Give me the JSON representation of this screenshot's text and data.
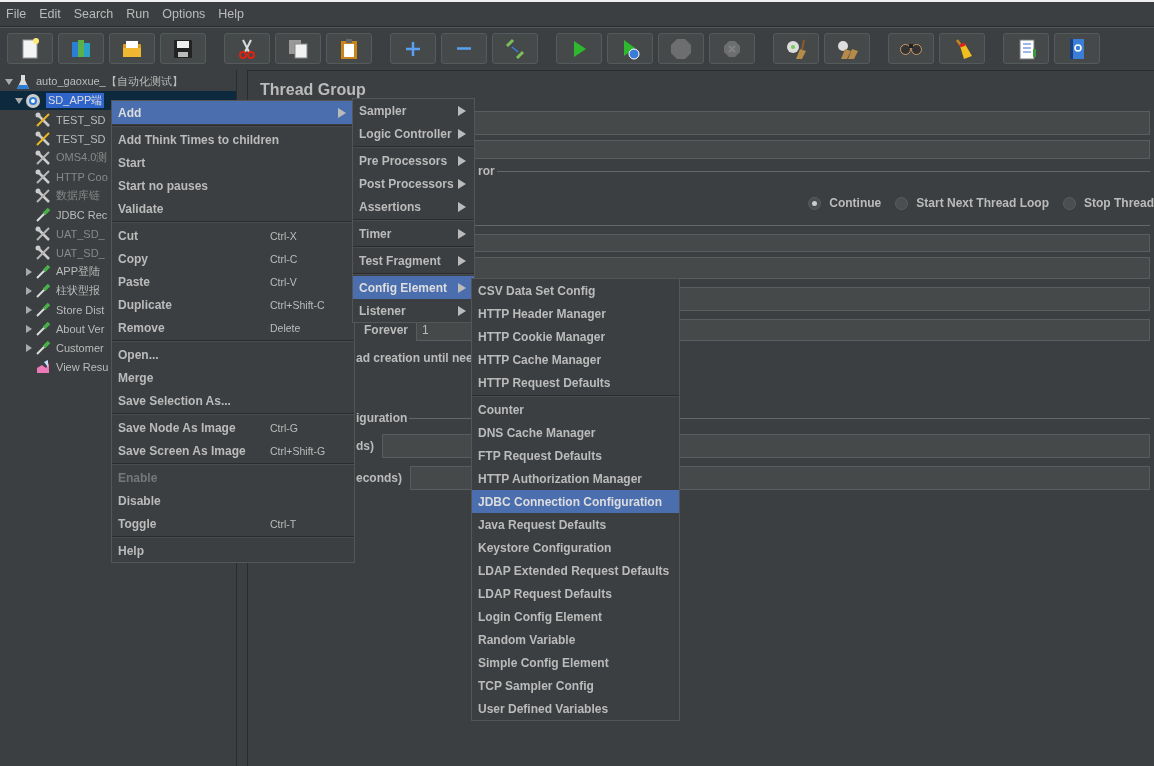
{
  "menubar": [
    "File",
    "Edit",
    "Search",
    "Run",
    "Options",
    "Help"
  ],
  "toolbar": {
    "groups": [
      [
        {
          "disabled": false
        },
        {
          "disabled": false
        },
        {
          "disabled": false
        },
        {
          "disabled": false
        }
      ],
      [
        {
          "disabled": false
        },
        {
          "disabled": false
        },
        {
          "disabled": false
        }
      ],
      [
        {
          "disabled": false
        },
        {
          "disabled": false
        },
        {
          "disabled": false
        }
      ],
      [
        {
          "disabled": false
        },
        {
          "disabled": false
        },
        {
          "disabled": true
        },
        {
          "disabled": true
        }
      ],
      [
        {
          "disabled": false
        },
        {
          "disabled": false
        }
      ],
      [
        {
          "disabled": false
        },
        {
          "disabled": false
        }
      ],
      [
        {
          "disabled": false
        },
        {
          "disabled": false
        }
      ]
    ]
  },
  "tree": [
    {
      "label": "auto_gaoxue_【自动化测试】",
      "kind": "plan",
      "expanded": true,
      "selected": false,
      "disabled": false,
      "children": [
        {
          "label": "SD_APP端",
          "kind": "threads",
          "expanded": true,
          "selected": true,
          "disabled": false,
          "children": [
            {
              "label": "TEST_SD",
              "kind": "config",
              "selected": false,
              "disabled": false
            },
            {
              "label": "TEST_SD",
              "kind": "config",
              "selected": false,
              "disabled": false
            },
            {
              "label": "OMS4.0测",
              "kind": "config",
              "selected": false,
              "disabled": true
            },
            {
              "label": "HTTP Coo",
              "kind": "config",
              "selected": false,
              "disabled": true
            },
            {
              "label": "数据库链",
              "kind": "config",
              "selected": false,
              "disabled": true
            },
            {
              "label": "JDBC Rec",
              "kind": "sampler",
              "selected": false,
              "disabled": false
            },
            {
              "label": "UAT_SD_",
              "kind": "config",
              "selected": false,
              "disabled": true
            },
            {
              "label": "UAT_SD_",
              "kind": "config",
              "selected": false,
              "disabled": true
            },
            {
              "label": "APP登陆",
              "kind": "sampler",
              "expanded": false,
              "selected": false,
              "disabled": false
            },
            {
              "label": "柱状型报",
              "kind": "sampler",
              "expanded": false,
              "selected": false,
              "disabled": false
            },
            {
              "label": "Store Dist",
              "kind": "sampler",
              "expanded": false,
              "selected": false,
              "disabled": false
            },
            {
              "label": "About Ver",
              "kind": "sampler",
              "expanded": false,
              "selected": false,
              "disabled": false
            },
            {
              "label": "Customer",
              "kind": "sampler",
              "expanded": false,
              "selected": false,
              "disabled": false
            },
            {
              "label": "View Resu",
              "kind": "listener",
              "selected": false,
              "disabled": false
            }
          ]
        }
      ]
    }
  ],
  "thread_group": {
    "title": "Thread Group",
    "error_legend": "ror",
    "error_actions": [
      {
        "label": "Continue",
        "selected": true
      },
      {
        "label": "Start Next Thread Loop",
        "selected": false
      },
      {
        "label": "Stop Thread",
        "selected": false
      }
    ],
    "loop_label": "Forever",
    "loop_value": "1",
    "delay_label": "ad creation until nee",
    "scheduler_legend": "iguration",
    "duration_label": "ds)",
    "startup_label": "econds)"
  },
  "context_menu": {
    "groups": [
      [
        {
          "label": "Add",
          "submenu": true,
          "selected": true,
          "disabled": false
        }
      ],
      [
        {
          "label": "Add Think Times to children",
          "selected": false,
          "disabled": false
        },
        {
          "label": "Start",
          "selected": false,
          "disabled": false
        },
        {
          "label": "Start no pauses",
          "selected": false,
          "disabled": false
        },
        {
          "label": "Validate",
          "selected": false,
          "disabled": false
        }
      ],
      [
        {
          "label": "Cut",
          "shortcut": "Ctrl-X",
          "selected": false,
          "disabled": false
        },
        {
          "label": "Copy",
          "shortcut": "Ctrl-C",
          "selected": false,
          "disabled": false
        },
        {
          "label": "Paste",
          "shortcut": "Ctrl-V",
          "selected": false,
          "disabled": false
        },
        {
          "label": "Duplicate",
          "shortcut": "Ctrl+Shift-C",
          "selected": false,
          "disabled": false
        },
        {
          "label": "Remove",
          "shortcut": "Delete",
          "selected": false,
          "disabled": false
        }
      ],
      [
        {
          "label": "Open...",
          "selected": false,
          "disabled": false
        },
        {
          "label": "Merge",
          "selected": false,
          "disabled": false
        },
        {
          "label": "Save Selection As...",
          "selected": false,
          "disabled": false
        }
      ],
      [
        {
          "label": "Save Node As Image",
          "shortcut": "Ctrl-G",
          "selected": false,
          "disabled": false
        },
        {
          "label": "Save Screen As Image",
          "shortcut": "Ctrl+Shift-G",
          "selected": false,
          "disabled": false
        }
      ],
      [
        {
          "label": "Enable",
          "selected": false,
          "disabled": true
        },
        {
          "label": "Disable",
          "selected": false,
          "disabled": false
        },
        {
          "label": "Toggle",
          "shortcut": "Ctrl-T",
          "selected": false,
          "disabled": false
        }
      ],
      [
        {
          "label": "Help",
          "selected": false,
          "disabled": false
        }
      ]
    ]
  },
  "add_menu": {
    "groups": [
      [
        {
          "label": "Sampler",
          "submenu": true,
          "selected": false
        },
        {
          "label": "Logic Controller",
          "submenu": true,
          "selected": false
        }
      ],
      [
        {
          "label": "Pre Processors",
          "submenu": true,
          "selected": false
        },
        {
          "label": "Post Processors",
          "submenu": true,
          "selected": false
        },
        {
          "label": "Assertions",
          "submenu": true,
          "selected": false
        }
      ],
      [
        {
          "label": "Timer",
          "submenu": true,
          "selected": false
        }
      ],
      [
        {
          "label": "Test Fragment",
          "submenu": true,
          "selected": false
        }
      ],
      [
        {
          "label": "Config Element",
          "submenu": true,
          "selected": true
        },
        {
          "label": "Listener",
          "submenu": true,
          "selected": false
        }
      ]
    ]
  },
  "config_menu": {
    "groups": [
      [
        {
          "label": "CSV Data Set Config",
          "selected": false
        },
        {
          "label": "HTTP Header Manager",
          "selected": false
        },
        {
          "label": "HTTP Cookie Manager",
          "selected": false
        },
        {
          "label": "HTTP Cache Manager",
          "selected": false
        },
        {
          "label": "HTTP Request Defaults",
          "selected": false
        }
      ],
      [
        {
          "label": "Counter",
          "selected": false
        },
        {
          "label": "DNS Cache Manager",
          "selected": false
        },
        {
          "label": "FTP Request Defaults",
          "selected": false
        },
        {
          "label": "HTTP Authorization Manager",
          "selected": false
        },
        {
          "label": "JDBC Connection Configuration",
          "selected": true
        },
        {
          "label": "Java Request Defaults",
          "selected": false
        },
        {
          "label": "Keystore Configuration",
          "selected": false
        },
        {
          "label": "LDAP Extended Request Defaults",
          "selected": false
        },
        {
          "label": "LDAP Request Defaults",
          "selected": false
        },
        {
          "label": "Login Config Element",
          "selected": false
        },
        {
          "label": "Random Variable",
          "selected": false
        },
        {
          "label": "Simple Config Element",
          "selected": false
        },
        {
          "label": "TCP Sampler Config",
          "selected": false
        },
        {
          "label": "User Defined Variables",
          "selected": false
        }
      ]
    ]
  }
}
